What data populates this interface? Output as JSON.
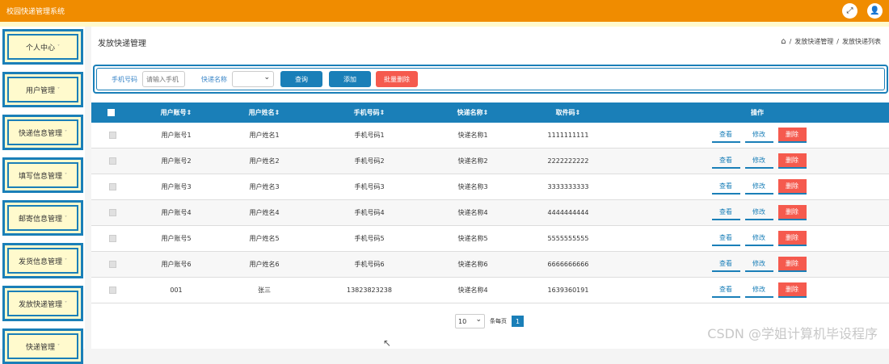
{
  "app": {
    "title": "校园快递管理系统"
  },
  "top_icons": {
    "fullscreen": "⤢",
    "user": "👤"
  },
  "sidebar": {
    "items": [
      {
        "label": "个人中心"
      },
      {
        "label": "用户管理"
      },
      {
        "label": "快递信息管理"
      },
      {
        "label": "填写信息管理"
      },
      {
        "label": "邮寄信息管理"
      },
      {
        "label": "发货信息管理"
      },
      {
        "label": "发放快递管理"
      },
      {
        "label": "快递管理"
      }
    ],
    "caret": "˅"
  },
  "page": {
    "title": "发放快递管理",
    "breadcrumb": [
      "/",
      "发放快递管理",
      "/",
      "发放快递列表"
    ]
  },
  "filters": {
    "phone_label": "手机号码",
    "phone_placeholder": "请输入手机",
    "express_label": "快递名称",
    "query": "查询",
    "add": "添加",
    "batch_delete": "批量删除"
  },
  "table": {
    "headers": [
      "用户账号",
      "用户姓名",
      "手机号码",
      "快递名称",
      "取件码",
      "操作"
    ],
    "rows": [
      [
        "用户账号1",
        "用户姓名1",
        "手机号码1",
        "快递名称1",
        "1111111111"
      ],
      [
        "用户账号2",
        "用户姓名2",
        "手机号码2",
        "快递名称2",
        "2222222222"
      ],
      [
        "用户账号3",
        "用户姓名3",
        "手机号码3",
        "快递名称3",
        "3333333333"
      ],
      [
        "用户账号4",
        "用户姓名4",
        "手机号码4",
        "快递名称4",
        "4444444444"
      ],
      [
        "用户账号5",
        "用户姓名5",
        "手机号码5",
        "快递名称5",
        "5555555555"
      ],
      [
        "用户账号6",
        "用户姓名6",
        "手机号码6",
        "快递名称6",
        "6666666666"
      ],
      [
        "001",
        "张三",
        "13823823238",
        "快递名称4",
        "1639360191"
      ]
    ],
    "actions": {
      "view": "查看",
      "edit": "修改",
      "delete": "删除"
    }
  },
  "pager": {
    "page_size": "10",
    "per_page_label": "条每页",
    "current": "1"
  },
  "watermark": "CSDN @学姐计算机毕设程序",
  "colors": {
    "topbar": "#f08c00",
    "primary": "#1a7fb8",
    "danger": "#f55a4e",
    "sidebar_fill": "#fffacd"
  }
}
